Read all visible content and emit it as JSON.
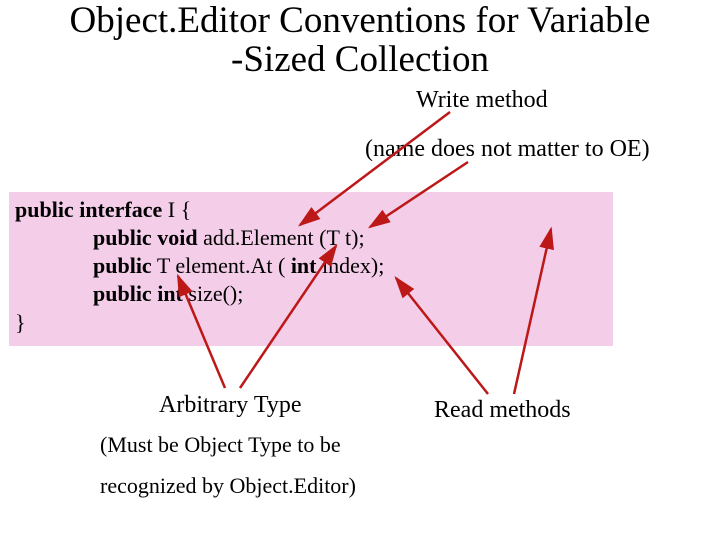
{
  "title_line1": "Object.Editor Conventions for Variable",
  "title_line2": "-Sized Collection",
  "write_method_label": "Write method",
  "name_note": "(name does not matter to OE)",
  "code": {
    "kw_public": "public",
    "kw_interface": "interface",
    "iface_name": " I {",
    "kw_void": "void",
    "add_method": " add.Element (T t);",
    "elem_method_pre": " T element.At (",
    "kw_int": "int",
    "elem_method_post": " index);",
    "size_method": " size();",
    "close": "}"
  },
  "arbitrary_type": "Arbitrary Type",
  "must_be": "(Must be Object Type to be",
  "recognized": "recognized by Object.Editor)",
  "read_methods": "Read methods",
  "colors": {
    "arrow": "#bd1818"
  }
}
